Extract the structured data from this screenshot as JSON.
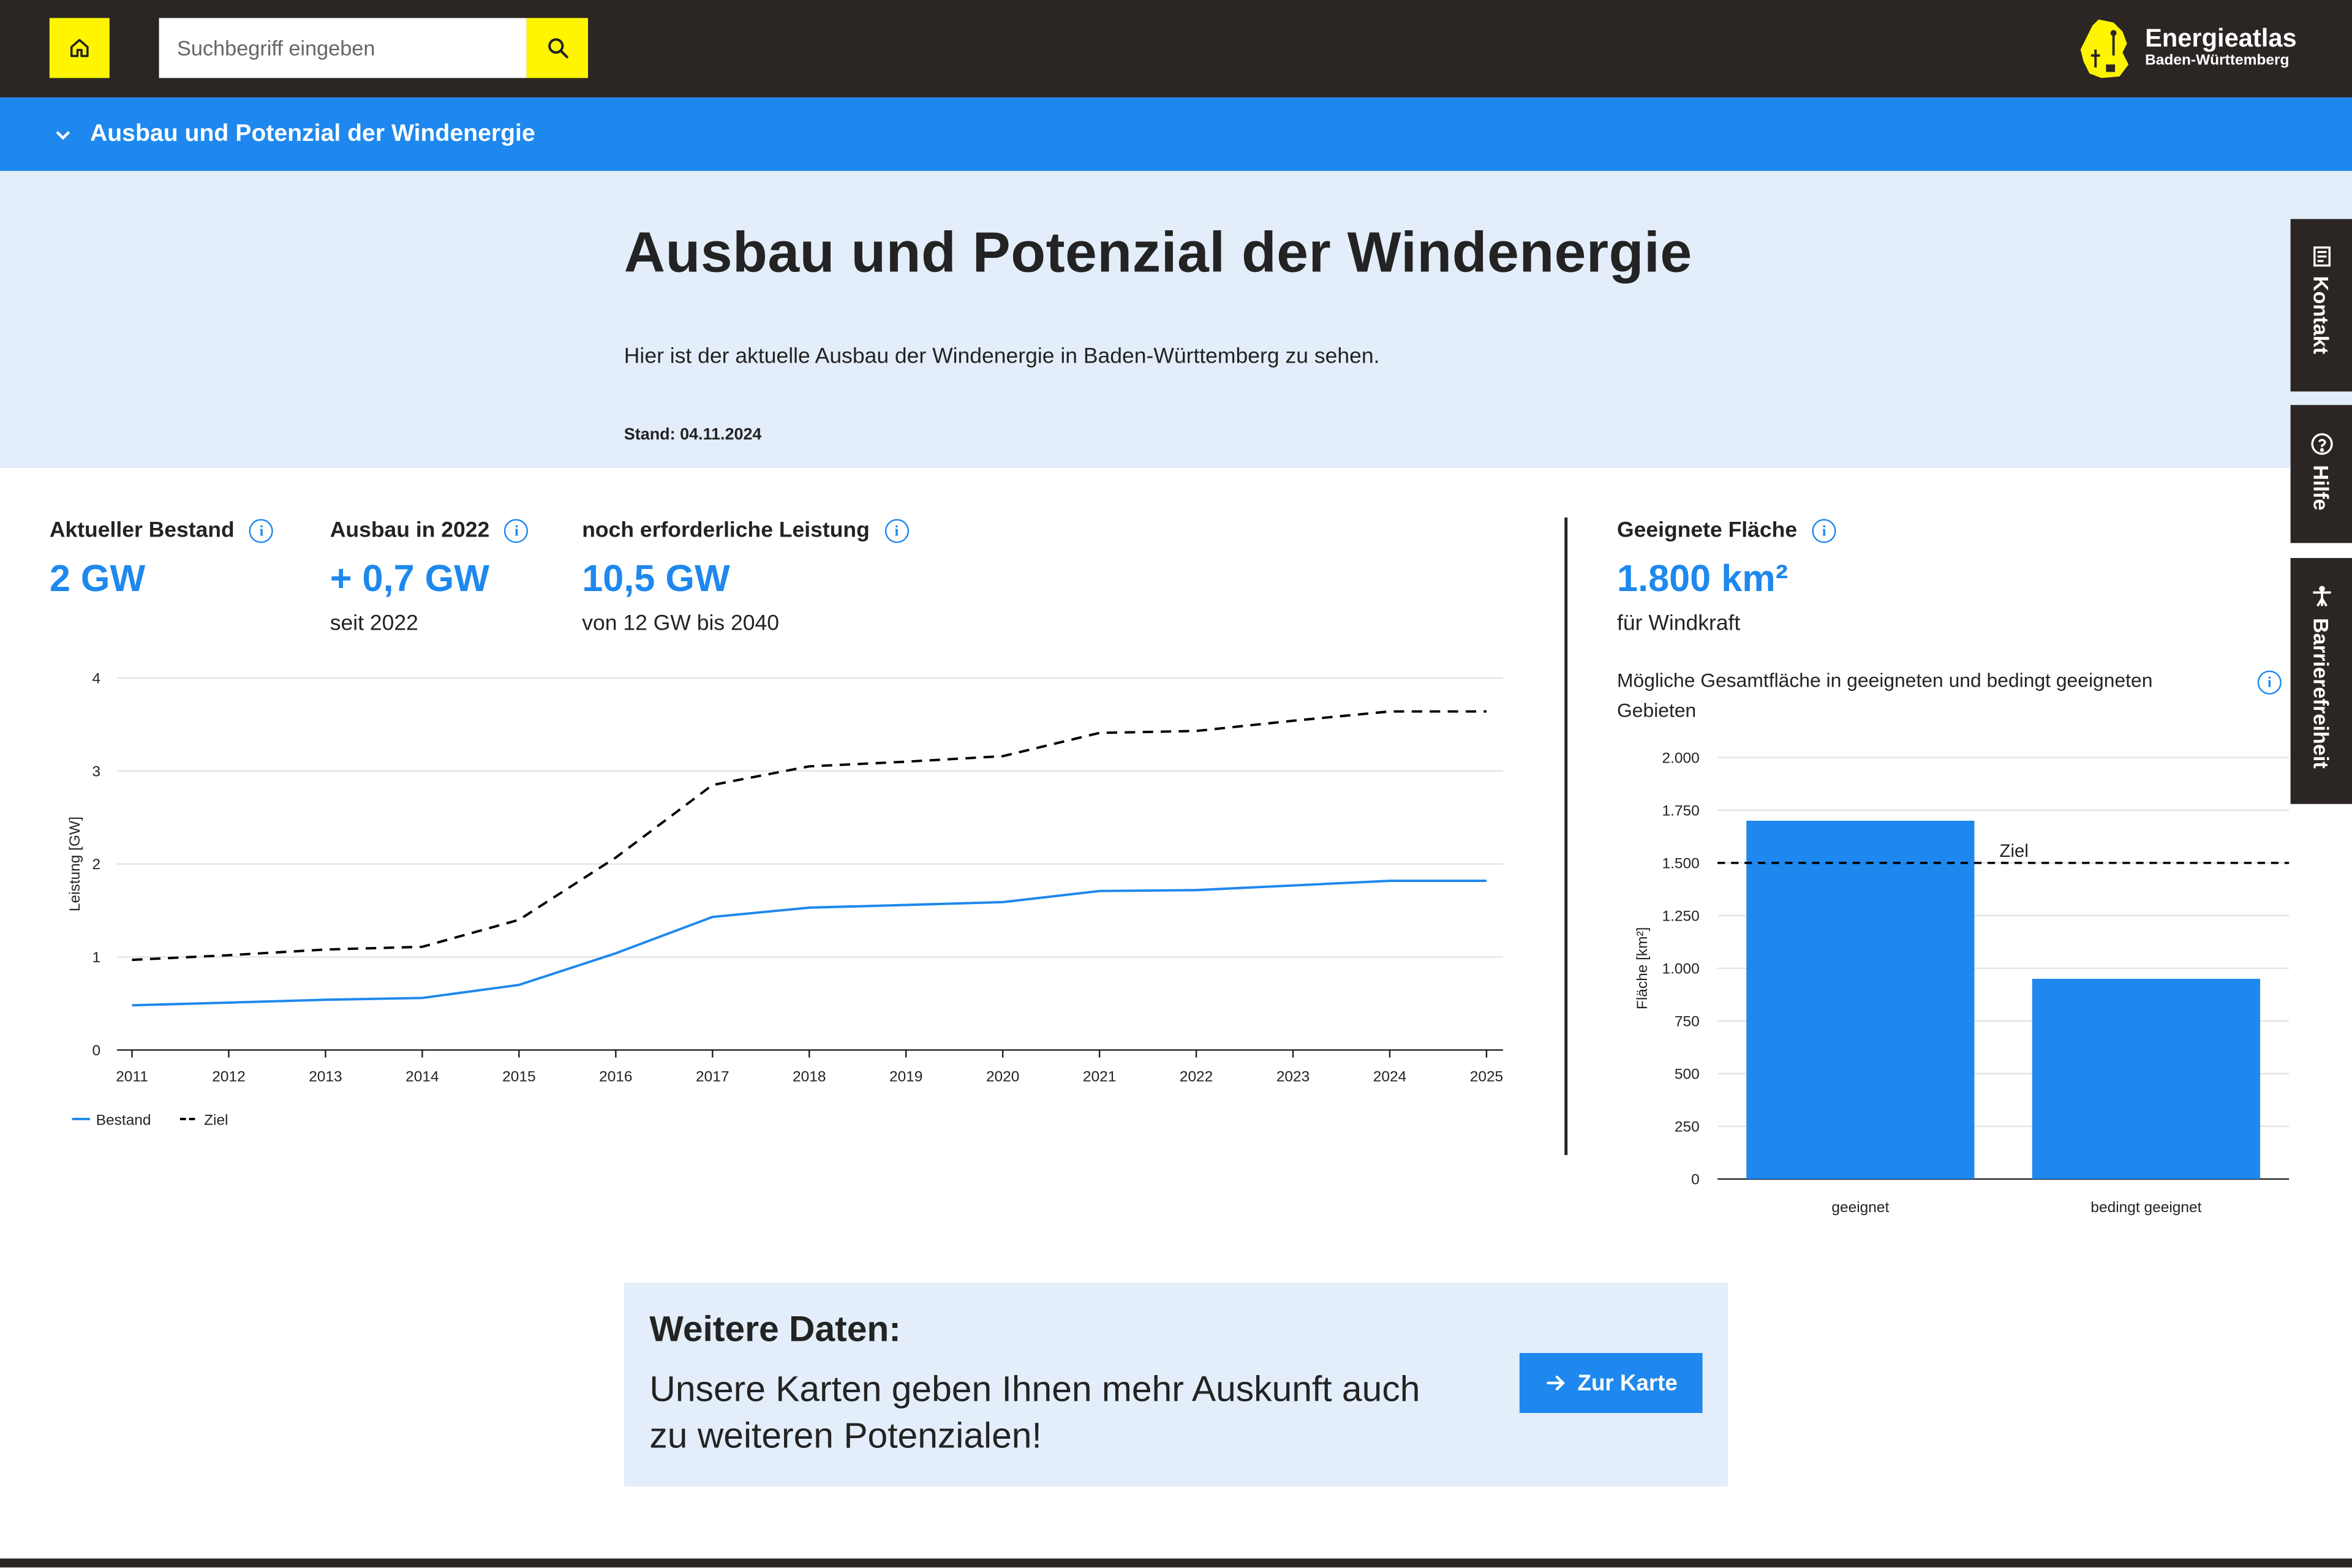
{
  "header": {
    "search_placeholder": "Suchbegriff eingeben",
    "logo_title": "Energieatlas",
    "logo_subtitle": "Baden-Württemberg"
  },
  "nav": {
    "breadcrumb_label": "Ausbau und Potenzial der Windenergie"
  },
  "hero": {
    "title": "Ausbau und Potenzial der Windenergie",
    "description": "Hier ist der aktuelle Ausbau der Windenergie in Baden-Württemberg zu sehen.",
    "stand": "Stand: 04.11.2024"
  },
  "side_tabs": [
    "Kontakt",
    "Hilfe",
    "Barrierefreiheit"
  ],
  "stats": [
    {
      "label": "Aktueller Bestand",
      "value": "2 GW",
      "sub": ""
    },
    {
      "label": "Ausbau in 2022",
      "value": "+ 0,7 GW",
      "sub": "seit 2022"
    },
    {
      "label": "noch erforderliche Leistung",
      "value": "10,5 GW",
      "sub": "von 12 GW bis 2040"
    }
  ],
  "area_stat": {
    "label": "Geeignete Fläche",
    "value": "1.800 km²",
    "sub": "für Windkraft",
    "description": "Mögliche Gesamtfläche in geeigneten und bedingt geeigneten Gebieten"
  },
  "chart_data": [
    {
      "type": "line",
      "ylabel": "Leistung [GW]",
      "xlabel": "",
      "ylim": [
        0,
        4
      ],
      "yticks": [
        "0",
        "1",
        "2",
        "3",
        "4"
      ],
      "x": [
        "2011",
        "2012",
        "2013",
        "2014",
        "2015",
        "2016",
        "2017",
        "2018",
        "2019",
        "2020",
        "2021",
        "2022",
        "2023",
        "2024",
        "2025"
      ],
      "series": [
        {
          "name": "Bestand",
          "color": "#1e88ee",
          "style": "solid",
          "values": [
            0.48,
            0.51,
            0.54,
            0.56,
            0.7,
            1.04,
            1.43,
            1.53,
            1.56,
            1.59,
            1.71,
            1.72,
            1.77,
            1.82,
            1.82
          ]
        },
        {
          "name": "Ziel",
          "color": "#000000",
          "style": "dashed",
          "values": [
            0.97,
            1.02,
            1.08,
            1.11,
            1.4,
            2.07,
            2.85,
            3.05,
            3.1,
            3.16,
            3.41,
            3.43,
            3.54,
            3.64,
            3.64
          ]
        }
      ],
      "legend_position": "bottom-left",
      "grid": true
    },
    {
      "type": "bar",
      "ylabel": "Fläche [km²]",
      "xlabel": "",
      "ylim": [
        0,
        2000
      ],
      "yticks": [
        "0",
        "250",
        "500",
        "750",
        "1.000",
        "1.250",
        "1.500",
        "1.750",
        "2.000"
      ],
      "categories": [
        "geeignet",
        "bedingt geeignet"
      ],
      "values": [
        1700,
        950
      ],
      "color": "#1e88ee",
      "reference_line": {
        "label": "Ziel",
        "value": 1500
      },
      "grid": true
    }
  ],
  "cta": {
    "heading": "Weitere Daten:",
    "text": "Unsere Karten geben Ihnen mehr Auskunft auch zu weiteren Potenzialen!",
    "button_label": "Zur Karte"
  },
  "colors": {
    "accent_blue": "#1e88ee",
    "accent_yellow": "#fff500",
    "dark": "#2b2624",
    "light_blue_bg": "#e3eefa"
  }
}
